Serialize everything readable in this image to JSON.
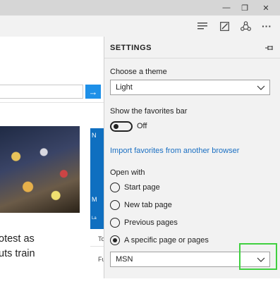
{
  "window": {
    "minimize_glyph": "—",
    "maximize_glyph": "❐",
    "close_glyph": "✕"
  },
  "toolbar": {
    "more_glyph": "···",
    "icons": [
      "hub-icon",
      "web-note-icon",
      "share-icon",
      "more-icon"
    ]
  },
  "webpage": {
    "search_button_glyph": "→",
    "headline_line1": "otest as",
    "headline_line2": "uts train",
    "side_card_letters": [
      "N",
      "M",
      "La"
    ],
    "side_texts": [
      "To",
      "Fu"
    ]
  },
  "settings": {
    "title": "SETTINGS",
    "theme_label": "Choose a theme",
    "theme_value": "Light",
    "favorites_bar_label": "Show the favorites bar",
    "favorites_bar_state": "Off",
    "import_link": "Import favorites from another browser",
    "open_with_label": "Open with",
    "open_with_options": [
      {
        "label": "Start page",
        "selected": false
      },
      {
        "label": "New tab page",
        "selected": false
      },
      {
        "label": "Previous pages",
        "selected": false
      },
      {
        "label": "A specific page or pages",
        "selected": true
      }
    ],
    "specific_page_value": "MSN"
  },
  "colors": {
    "accent": "#1e90e8",
    "link": "#1a6fc2",
    "highlight": "#40d040"
  }
}
